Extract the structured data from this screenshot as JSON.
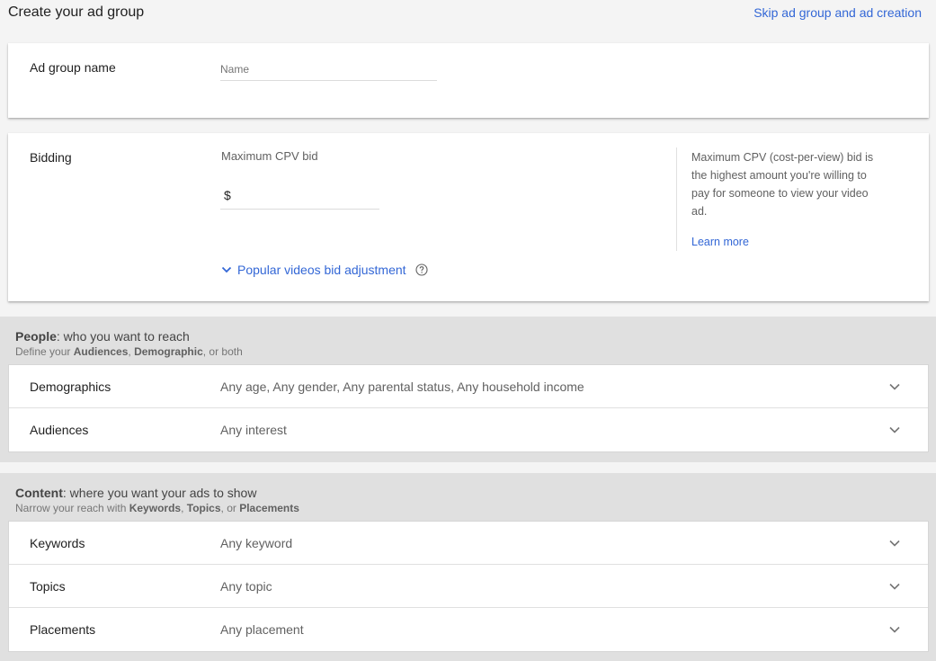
{
  "header": {
    "title": "Create your ad group",
    "skip_link": "Skip ad group and ad creation"
  },
  "ad_group_name": {
    "label": "Ad group name",
    "placeholder": "Name",
    "value": ""
  },
  "bidding": {
    "label": "Bidding",
    "bid_title": "Maximum CPV bid",
    "currency": "$",
    "value": "",
    "popular_adjustment": "Popular videos bid adjustment",
    "help_text": "Maximum CPV (cost-per-view) bid is the highest amount you're willing to pay for someone to view your video ad.",
    "learn_more": "Learn more"
  },
  "people": {
    "title_bold": "People",
    "title_rest": ": who you want to reach",
    "sub_prefix": "Define your ",
    "sub_audiences": "Audiences",
    "sub_comma": ", ",
    "sub_demographic": "Demographic",
    "sub_suffix": ", or both",
    "rows": [
      {
        "label": "Demographics",
        "value": "Any age, Any gender, Any parental status, Any household income"
      },
      {
        "label": "Audiences",
        "value": "Any interest"
      }
    ]
  },
  "content": {
    "title_bold": "Content",
    "title_rest": ": where you want your ads to show",
    "sub_prefix": "Narrow your reach with ",
    "sub_keywords": "Keywords",
    "sub_comma": ", ",
    "sub_topics": "Topics",
    "sub_or": ", or ",
    "sub_placements": "Placements",
    "rows": [
      {
        "label": "Keywords",
        "value": "Any keyword"
      },
      {
        "label": "Topics",
        "value": "Any topic"
      },
      {
        "label": "Placements",
        "value": "Any placement"
      }
    ]
  },
  "icons": {
    "expand": "chevron-down-icon",
    "help": "help-circle-icon"
  },
  "colors": {
    "accent": "#3367d6",
    "background": "#f4f4f4",
    "section_bg": "#e0e0e0"
  }
}
